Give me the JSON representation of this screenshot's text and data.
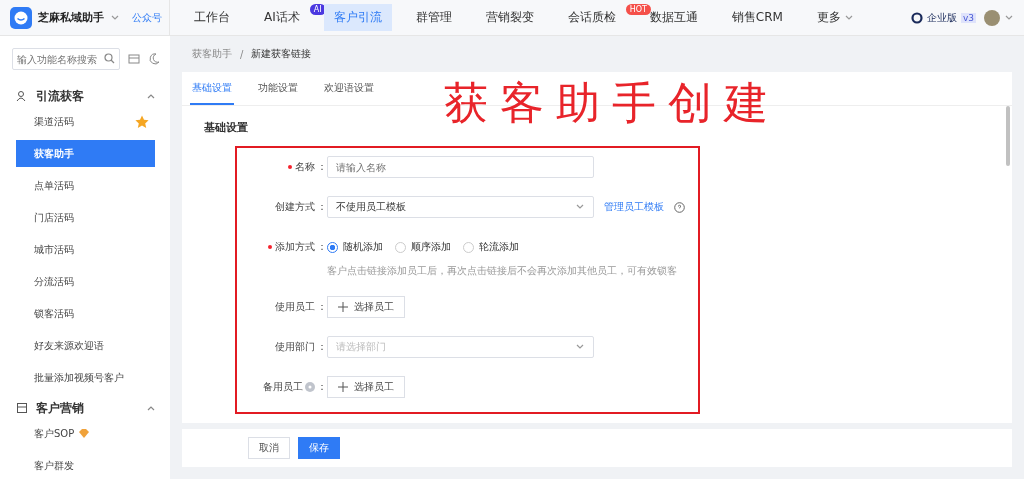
{
  "header": {
    "brand": "芝麻私域助手",
    "brand_link": "公众号",
    "nav": [
      {
        "label": "工作台",
        "selected": false
      },
      {
        "label": "AI话术",
        "selected": false,
        "badge": "AI"
      },
      {
        "label": "客户引流",
        "selected": true
      },
      {
        "label": "群管理",
        "selected": false
      },
      {
        "label": "营销裂变",
        "selected": false
      },
      {
        "label": "会话质检",
        "selected": false,
        "badge": "HOT"
      },
      {
        "label": "数据互通",
        "selected": false
      },
      {
        "label": "销售CRM",
        "selected": false
      },
      {
        "label": "更多",
        "selected": false,
        "dropdown": true
      }
    ],
    "edition": "企业版",
    "version": "v3"
  },
  "sidebar": {
    "search_placeholder": "输入功能名称搜索",
    "groups": [
      {
        "title": "引流获客",
        "expanded": true,
        "items": [
          {
            "label": "渠道活码",
            "selected": false,
            "starred": true
          },
          {
            "label": "获客助手",
            "selected": true,
            "starred": false
          },
          {
            "label": "点单活码",
            "selected": false,
            "starred": false
          },
          {
            "label": "门店活码",
            "selected": false,
            "starred": false
          },
          {
            "label": "城市活码",
            "selected": false,
            "starred": false
          },
          {
            "label": "分流活码",
            "selected": false,
            "starred": false
          },
          {
            "label": "锁客活码",
            "selected": false,
            "starred": false
          },
          {
            "label": "好友来源欢迎语",
            "selected": false,
            "starred": false
          },
          {
            "label": "批量添加视频号客户",
            "selected": false,
            "starred": false
          }
        ]
      },
      {
        "title": "客户营销",
        "expanded": true,
        "items": [
          {
            "label": "客户SOP",
            "selected": false,
            "starred": false,
            "vip": true
          },
          {
            "label": "客户群发",
            "selected": false,
            "starred": false
          }
        ]
      }
    ]
  },
  "breadcrumb": {
    "items": [
      "获客助手",
      "新建获客链接"
    ],
    "separator": "/"
  },
  "tabs": [
    {
      "label": "基础设置",
      "selected": true
    },
    {
      "label": "功能设置",
      "selected": false
    },
    {
      "label": "欢迎语设置",
      "selected": false
    }
  ],
  "annotation": "获客助手创建",
  "section_title": "基础设置",
  "form": [
    {
      "kind": "input",
      "label": "名称",
      "colon": "：",
      "required": true,
      "placeholder": "请输入名称"
    },
    {
      "kind": "select",
      "label": "创建方式",
      "colon": "：",
      "required": false,
      "value": "不使用员工模板",
      "link": "管理员工模板"
    },
    {
      "kind": "radio",
      "label": "添加方式",
      "colon": "：",
      "required": true,
      "options": [
        {
          "label": "随机添加",
          "selected": true
        },
        {
          "label": "顺序添加",
          "selected": false
        },
        {
          "label": "轮流添加",
          "selected": false
        }
      ],
      "hint": "客户点击链接添加员工后，再次点击链接后不会再次添加其他员工，可有效锁客"
    },
    {
      "kind": "picker",
      "label": "使用员工",
      "colon": "：",
      "required": false,
      "button": "选择员工"
    },
    {
      "kind": "select",
      "label": "使用部门",
      "colon": "：",
      "required": false,
      "placeholder": "请选择部门"
    },
    {
      "kind": "picker",
      "label": "备用员工",
      "colon": "：",
      "required": false,
      "button": "选择员工",
      "help": true
    }
  ],
  "footer": {
    "cancel": "取消",
    "save": "保存"
  }
}
